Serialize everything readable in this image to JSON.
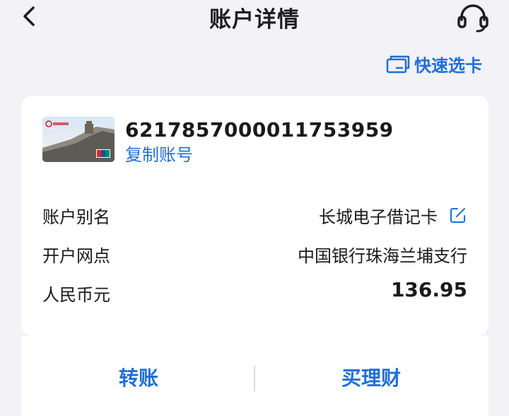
{
  "header": {
    "title": "账户详情",
    "back_icon": "chevron-left-icon",
    "support_icon": "headset-icon"
  },
  "quick_select": {
    "label": "快速选卡",
    "icon": "card-stack-icon"
  },
  "account": {
    "card_image": "bank-card-thumbnail",
    "number": "6217857000011753959",
    "copy_label": "复制账号",
    "rows": [
      {
        "label": "账户别名",
        "value": "长城电子借记卡",
        "edit_icon": "edit-icon"
      },
      {
        "label": "开户网点",
        "value": "中国银行珠海兰埔支行"
      },
      {
        "label": "人民币元",
        "value": "136.95"
      }
    ]
  },
  "actions": {
    "transfer_label": "转账",
    "finance_label": "买理财"
  },
  "colors": {
    "accent": "#1f6fd6",
    "background": "#f2f2f7",
    "card": "#ffffff"
  }
}
